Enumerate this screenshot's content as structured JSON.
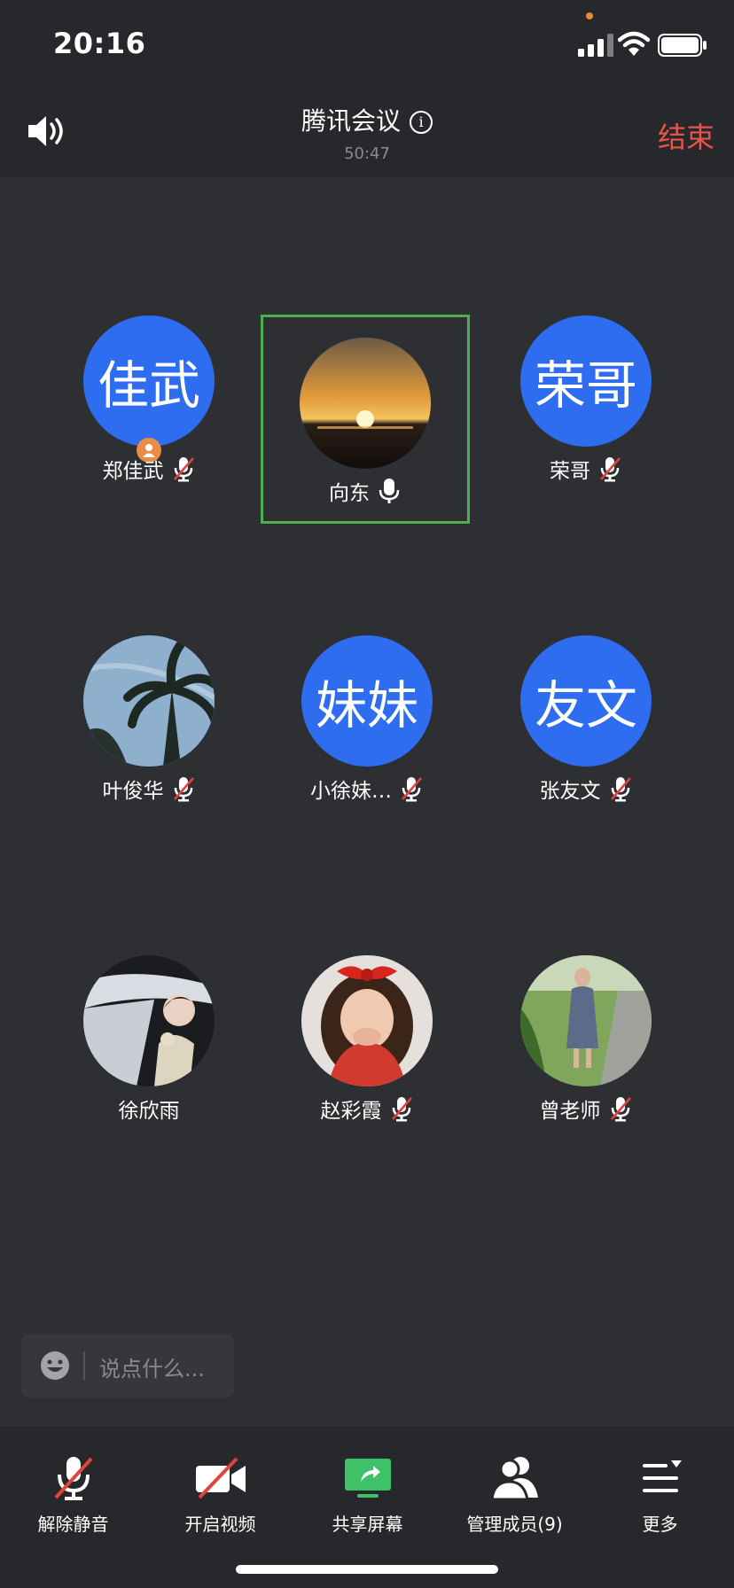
{
  "status": {
    "time": "20:16"
  },
  "header": {
    "title": "腾讯会议",
    "timer": "50:47",
    "end_label": "结束"
  },
  "participants": [
    {
      "name": "郑佳武",
      "avatar_text": "佳武",
      "muted": true,
      "host": true
    },
    {
      "name": "向东",
      "avatar_text": "",
      "muted": false,
      "active_speaker": true
    },
    {
      "name": "荣哥",
      "avatar_text": "荣哥",
      "muted": true
    },
    {
      "name": "叶俊华",
      "avatar_text": "",
      "muted": true
    },
    {
      "name": "小徐妹…",
      "avatar_text": "妹妹",
      "muted": true
    },
    {
      "name": "张友文",
      "avatar_text": "友文",
      "muted": true
    },
    {
      "name": "徐欣雨",
      "avatar_text": "",
      "muted": false
    },
    {
      "name": "赵彩霞",
      "avatar_text": "",
      "muted": true
    },
    {
      "name": "曾老师",
      "avatar_text": "",
      "muted": true
    }
  ],
  "chat": {
    "placeholder": "说点什么..."
  },
  "toolbar": {
    "unmute": "解除静音",
    "video": "开启视频",
    "share": "共享屏幕",
    "members": "管理成员(9)",
    "more": "更多"
  },
  "colors": {
    "accent": "#2f6df0",
    "end": "#e8534a",
    "active_border": "#4caf50",
    "share": "#3ec168",
    "muted": "#e0433a"
  }
}
